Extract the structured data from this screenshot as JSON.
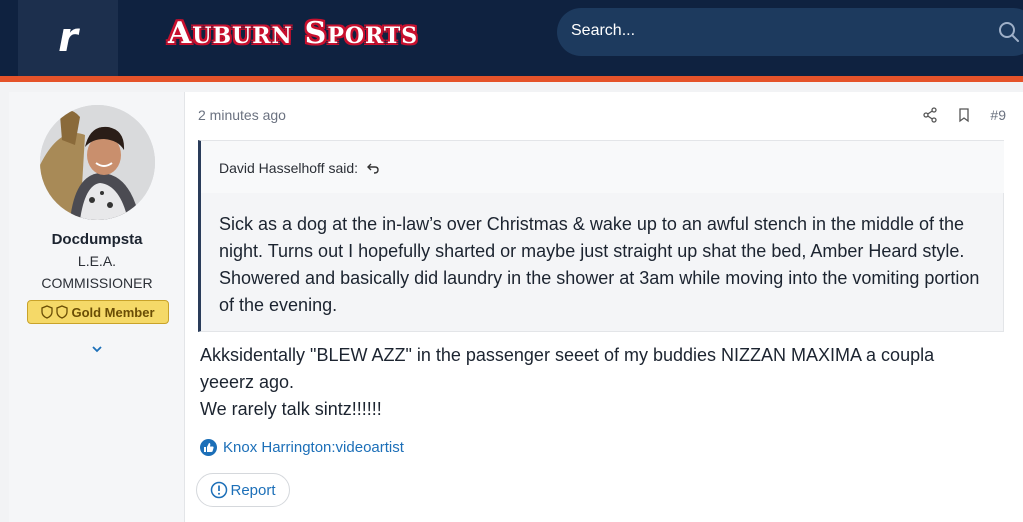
{
  "header": {
    "logo_letter": "r",
    "brand_first_big": "A",
    "brand_first_rest": "UBURN",
    "brand_second_big": "S",
    "brand_second_rest": "PORTS",
    "search_placeholder": "Search...",
    "colors": {
      "bar": "#0f2240",
      "accent": "#e5532a"
    }
  },
  "user": {
    "name": "Docdumpsta",
    "title_line1": "L.E.A.",
    "title_line2": "COMMISSIONER",
    "badge": "Gold Member"
  },
  "post": {
    "time": "2 minutes ago",
    "number": "#9",
    "quote": {
      "author_label": "David Hasselhoff said:",
      "body": "Sick as a dog at the in-law’s over Christmas & wake up to an awful stench in the middle of the night. Turns out I hopefully sharted or maybe just straight up shat the bed, Amber Heard style. Showered and basically did laundry in the shower at 3am while moving into the vomiting portion of the evening."
    },
    "message_lines": [
      "Akksidentally \"BLEW AZZ\" in the passenger seeet of my buddies NIZZAN MAXIMA a coupla",
      "yeeerz ago.",
      "We rarely talk sintz!!!!!!"
    ],
    "reaction_user": "Knox Harrington:videoartist",
    "report_label": "Report"
  }
}
